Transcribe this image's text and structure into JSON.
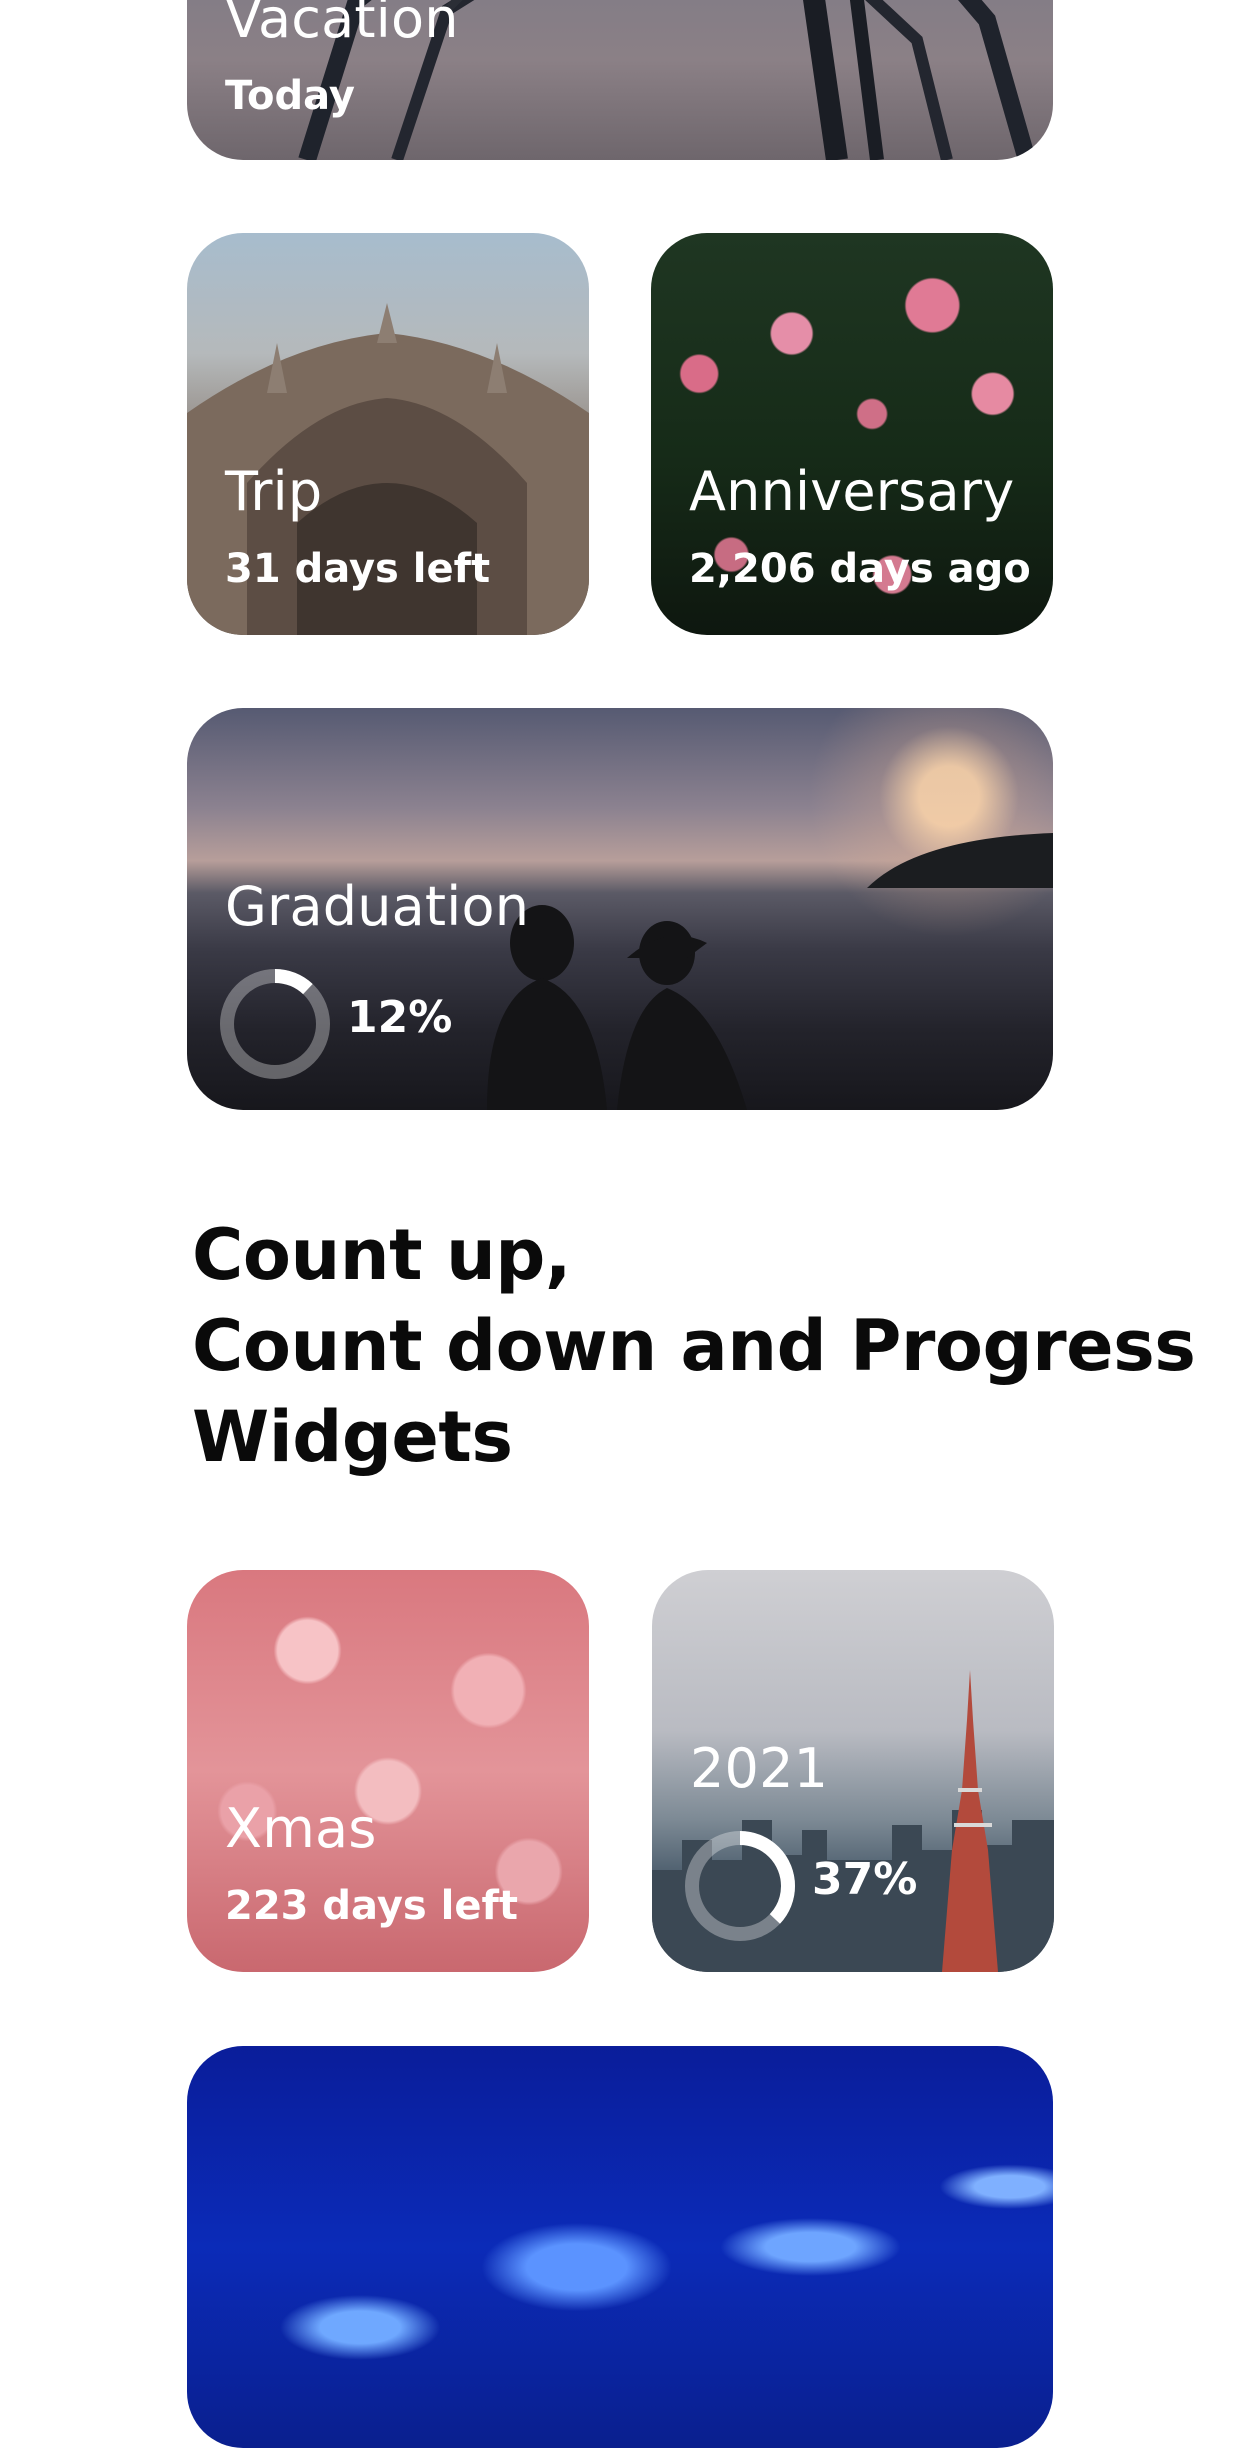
{
  "widgets": [
    {
      "id": "vacation",
      "title": "Vacation",
      "subtitle": "Today"
    },
    {
      "id": "trip",
      "title": "Trip",
      "subtitle": "31 days left"
    },
    {
      "id": "anniversary",
      "title": "Anniversary",
      "subtitle": "2,206 days ago"
    },
    {
      "id": "graduation",
      "title": "Graduation",
      "progress_label": "12%",
      "progress": 0.12
    },
    {
      "id": "xmas",
      "title": "Xmas",
      "subtitle": "223 days left"
    },
    {
      "id": "year-2021",
      "title": "2021",
      "progress_label": "37%",
      "progress": 0.37
    }
  ],
  "heading": {
    "line1": "Count up,",
    "line2": "Count down and Progress",
    "line3": "Widgets"
  }
}
